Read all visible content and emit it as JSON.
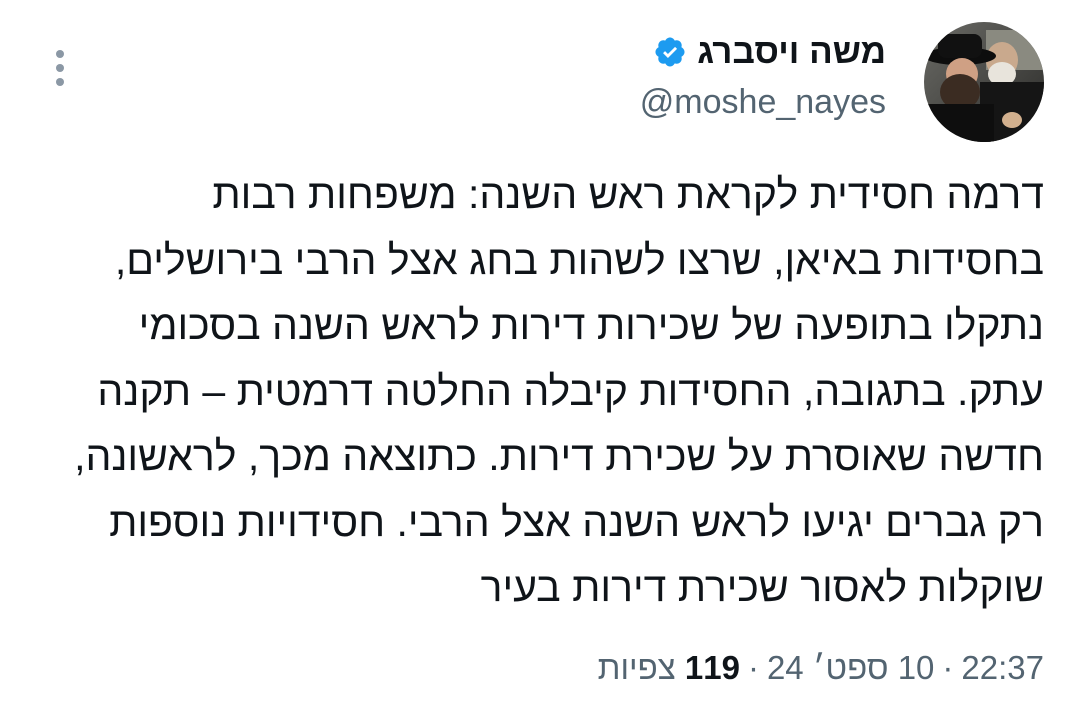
{
  "author": {
    "display_name": "משה ויסברג",
    "handle": "@moshe_nayes",
    "verified": true,
    "verified_color": "#1d9bf0"
  },
  "tweet": {
    "text": "דרמה חסידית לקראת ראש השנה: משפחות רבות\nבחסידות באיאן, שרצו לשהות בחג אצל הרבי בירושלים,\nנתקלו בתופעה של שכירות דירות לראש השנה בסכומי\nעתק. בתגובה, החסידות קיבלה החלטה דרמטית – תקנה\nחדשה שאוסרת על שכירת דירות. כתוצאה מכך, לראשונה,\nרק גברים יגיעו לראש השנה אצל הרבי. חסידויות נוספות\nשוקלות לאסור שכירת דירות בעיר"
  },
  "meta": {
    "time": "22:37",
    "separator": "·",
    "date": "10 ספט׳ 24",
    "views_count": "119",
    "views_label": "צפיות"
  },
  "icons": {
    "avatar": "avatar-photo",
    "verified": "verified-badge-icon",
    "more": "more-options-icon"
  }
}
